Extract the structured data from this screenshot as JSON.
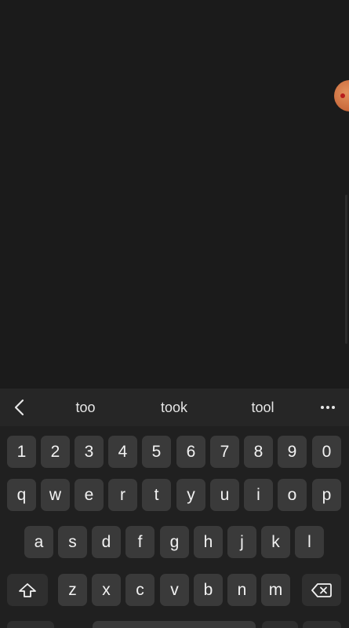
{
  "suggestions": {
    "back_icon": "chevron-left-icon",
    "words": [
      "too",
      "took",
      "tool"
    ],
    "more_icon": "more-horizontal-icon"
  },
  "keyboard": {
    "number_row": [
      "1",
      "2",
      "3",
      "4",
      "5",
      "6",
      "7",
      "8",
      "9",
      "0"
    ],
    "row1": [
      "q",
      "w",
      "e",
      "r",
      "t",
      "y",
      "u",
      "i",
      "o",
      "p"
    ],
    "row2": [
      "a",
      "s",
      "d",
      "f",
      "g",
      "h",
      "j",
      "k",
      "l"
    ],
    "row3": [
      "z",
      "x",
      "c",
      "v",
      "b",
      "n",
      "m"
    ],
    "shift_icon": "shift-arrow-icon",
    "backspace_icon": "backspace-icon"
  },
  "colors": {
    "background": "#1b1b1b",
    "key": "#3a3a3a",
    "key_text": "#f2f2f2",
    "bubble": "#d07a48"
  }
}
